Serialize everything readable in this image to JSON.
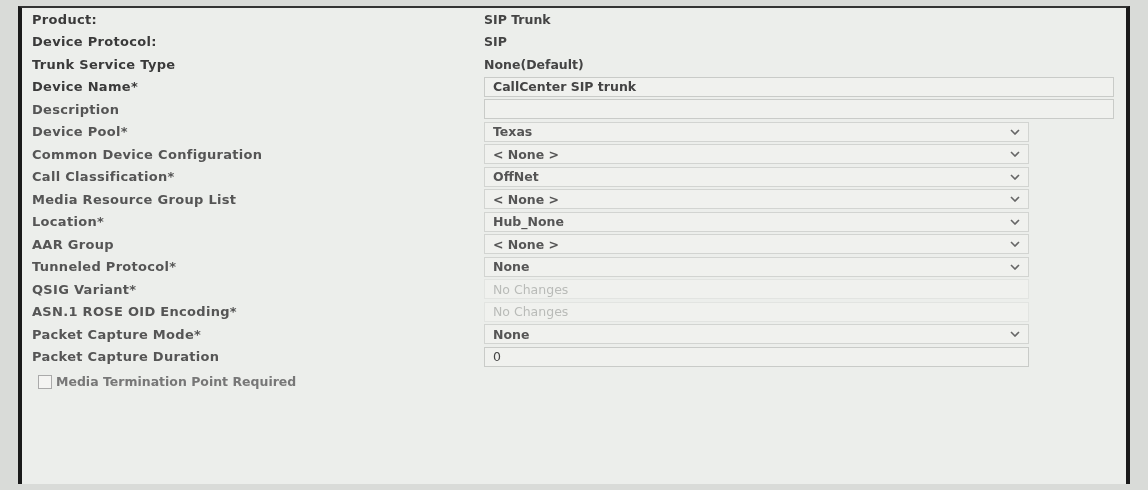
{
  "fields": [
    {
      "label": "Product:",
      "kind": "static",
      "value": "SIP Trunk"
    },
    {
      "label": "Device Protocol:",
      "kind": "static",
      "value": "SIP"
    },
    {
      "label": "Trunk Service Type",
      "kind": "static",
      "value": "None(Default)"
    },
    {
      "label": "Device Name*",
      "kind": "text",
      "value": "CallCenter SIP trunk"
    },
    {
      "label": "Description",
      "kind": "text"
    },
    {
      "label": "Device Pool*",
      "kind": "select",
      "value": "Texas",
      "disabled": false
    },
    {
      "label": "Common Device Configuration",
      "kind": "select",
      "value": "< None >",
      "disabled": false
    },
    {
      "label": "Call Classification*",
      "kind": "select",
      "value": "OffNet",
      "disabled": false
    },
    {
      "label": "Media Resource Group List",
      "kind": "select",
      "value": "< None >",
      "disabled": false
    },
    {
      "label": "Location*",
      "kind": "select",
      "value": "Hub_None",
      "disabled": false
    },
    {
      "label": "AAR Group",
      "kind": "select",
      "value": "< None >",
      "disabled": false
    },
    {
      "label": "Tunneled Protocol*",
      "kind": "select",
      "value": "None",
      "disabled": false
    },
    {
      "label": "QSIG Variant*",
      "kind": "select",
      "value": "No Changes",
      "disabled": true
    },
    {
      "label": "ASN.1 ROSE OID Encoding*",
      "kind": "select",
      "value": "No Changes",
      "disabled": true
    },
    {
      "label": "Packet Capture Mode*",
      "kind": "select",
      "value": "None",
      "disabled": false
    },
    {
      "label": "Packet Capture Duration",
      "kind": "text",
      "value": "0"
    }
  ],
  "checkbox": {
    "label": "Media Termination Point Required",
    "checked": false
  }
}
